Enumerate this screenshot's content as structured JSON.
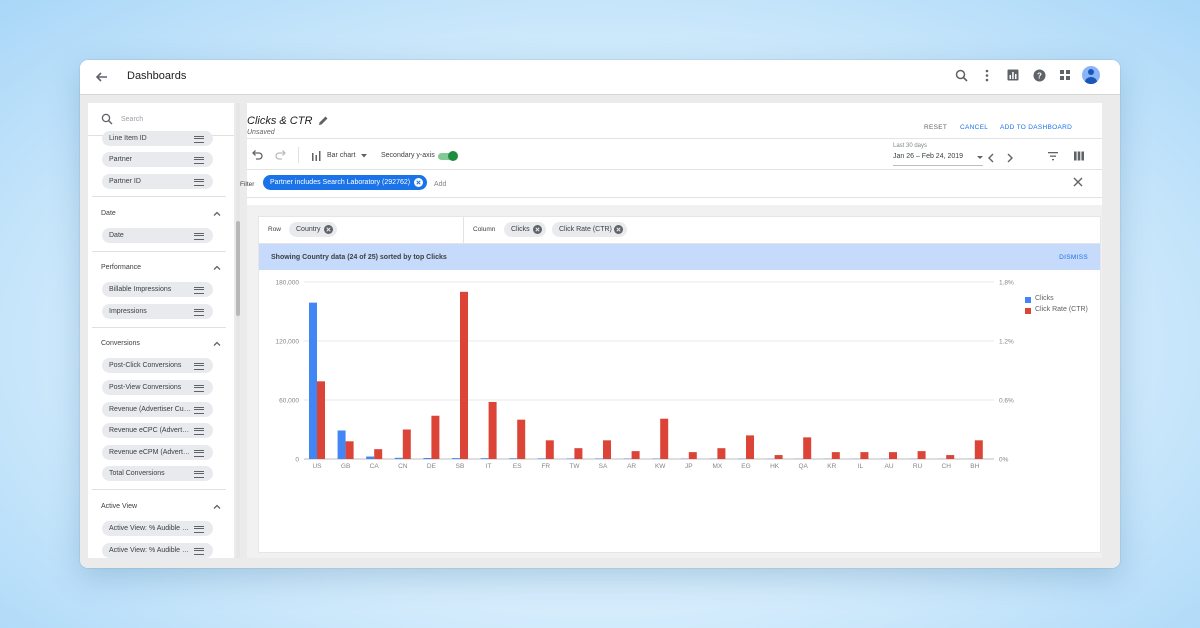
{
  "appbar": {
    "title": "Dashboards"
  },
  "sidebar": {
    "search_placeholder": "Search",
    "top_items": [
      "Line Item ID",
      "Partner",
      "Partner ID"
    ],
    "sections": [
      {
        "title": "Date",
        "items": [
          "Date"
        ]
      },
      {
        "title": "Performance",
        "items": [
          "Billable Impressions",
          "Impressions"
        ]
      },
      {
        "title": "Conversions",
        "items": [
          "Post-Click Conversions",
          "Post-View Conversions",
          "Revenue (Advertiser Cu…",
          "Revenue eCPC (Advert…",
          "Revenue eCPM (Advert…",
          "Total Conversions"
        ]
      },
      {
        "title": "Active View",
        "items": [
          "Active View: % Audible …",
          "Active View: % Audible …"
        ]
      }
    ]
  },
  "report": {
    "title": "Clicks & CTR",
    "status": "Unsaved",
    "reset": "RESET",
    "cancel": "CANCEL",
    "add": "ADD TO DASHBOARD",
    "chart_type": "Bar chart",
    "secondary_axis_label": "Secondary y-axis",
    "secondary_axis_on": true,
    "date_label": "Last 30 days",
    "date_value": "Jan 26 – Feb 24, 2019",
    "filter_label": "Filter",
    "filter_chip": "Partner includes Search Laboratory (292762)",
    "filter_add": "Add",
    "row_label": "Row",
    "row_chips": [
      "Country"
    ],
    "column_label": "Column",
    "column_chips": [
      "Clicks",
      "Click Rate (CTR)"
    ],
    "banner_text": "Showing Country data (24 of 25) sorted by top Clicks",
    "dismiss": "DISMISS"
  },
  "colors": {
    "clicks": "#4285f4",
    "ctr": "#db4437",
    "accent": "#1a73e8"
  },
  "chart_data": {
    "type": "bar",
    "categories": [
      "US",
      "GB",
      "CA",
      "CN",
      "DE",
      "SB",
      "IT",
      "ES",
      "FR",
      "TW",
      "SA",
      "AR",
      "KW",
      "JP",
      "MX",
      "EG",
      "HK",
      "QA",
      "KR",
      "IL",
      "AU",
      "RU",
      "CH",
      "BH"
    ],
    "series": [
      {
        "name": "Clicks",
        "axis": "left",
        "values": [
          159000,
          29000,
          2500,
          1200,
          1000,
          900,
          800,
          700,
          600,
          500,
          500,
          400,
          400,
          300,
          300,
          300,
          200,
          200,
          200,
          200,
          200,
          200,
          100,
          100
        ]
      },
      {
        "name": "Click Rate (CTR)",
        "axis": "right",
        "values": [
          0.79,
          0.18,
          0.1,
          0.3,
          0.44,
          1.7,
          0.58,
          0.4,
          0.19,
          0.11,
          0.19,
          0.08,
          0.41,
          0.07,
          0.11,
          0.24,
          0.04,
          0.22,
          0.07,
          0.07,
          0.07,
          0.08,
          0.04,
          0.19
        ]
      }
    ],
    "y_left": {
      "ticks": [
        "0",
        "60,000",
        "120,000",
        "180,000"
      ],
      "range": [
        0,
        180000
      ]
    },
    "y_right": {
      "ticks": [
        "0%",
        "0.6%",
        "1.2%",
        "1.8%"
      ],
      "range": [
        0,
        1.8
      ]
    },
    "grid": true,
    "legend_position": "top-right"
  }
}
